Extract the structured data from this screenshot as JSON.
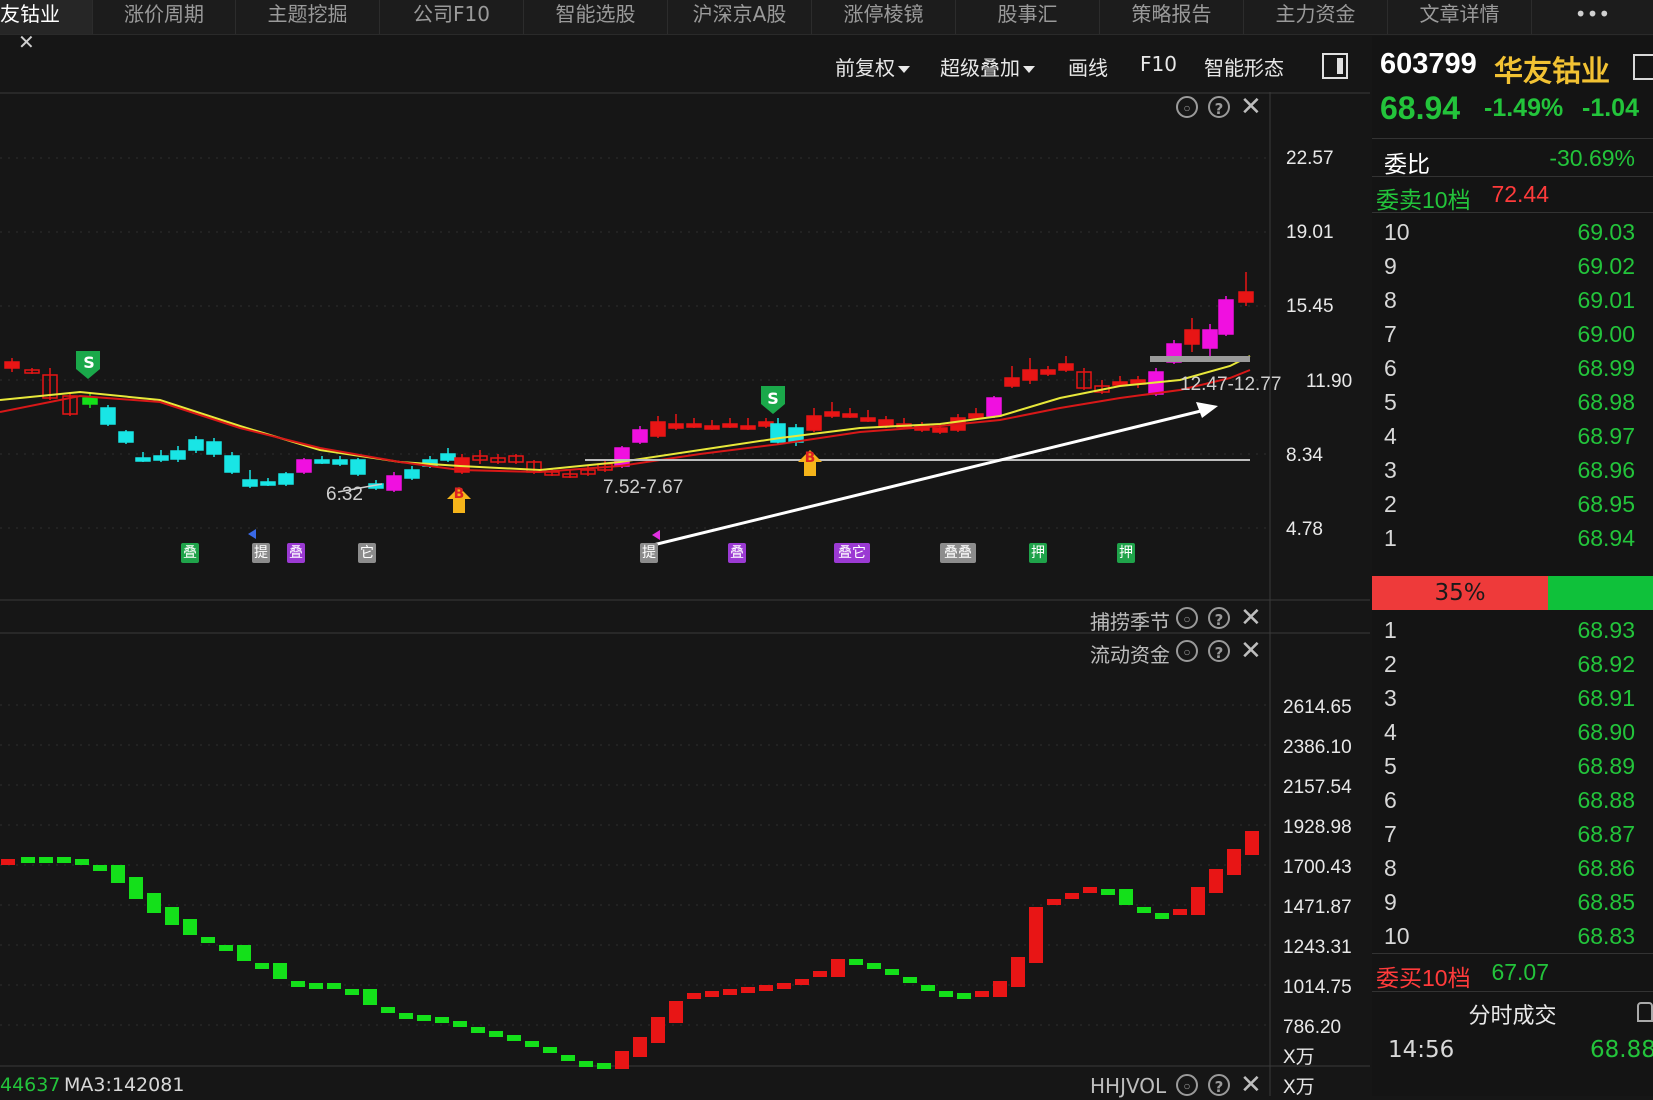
{
  "tabs": [
    "友钴业",
    "涨价周期",
    "主题挖掘",
    "公司F10",
    "智能选股",
    "沪深京A股",
    "涨停棱镜",
    "股事汇",
    "策略报告",
    "主力资金",
    "文章详情"
  ],
  "tab_close": "✕",
  "more": "•••",
  "toolbar": {
    "fuquan": "前复权",
    "diejia": "超级叠加",
    "huaxian": "画线",
    "f10": "F10",
    "xingtai": "智能形态"
  },
  "price_axis": [
    "22.57",
    "19.01",
    "15.45",
    "11.90",
    "8.34",
    "4.78"
  ],
  "flow_axis": [
    "2614.65",
    "2386.10",
    "2157.54",
    "1928.98",
    "1700.43",
    "1471.87",
    "1243.31",
    "1014.75",
    "786.20"
  ],
  "unit": "X万",
  "chart_labels": {
    "low1": "6.32",
    "range1": "7.52-7.67",
    "range2": "12.47-12.77"
  },
  "signals": {
    "s": "S",
    "b": "B"
  },
  "event_tags": [
    "叠",
    "提",
    "叠",
    "它",
    "提",
    "叠",
    "叠它",
    "叠叠",
    "押",
    "押"
  ],
  "pane_titles": {
    "season": "捕捞季节",
    "flow": "流动资金",
    "vol": "HHJVOL"
  },
  "pane_icons": {
    "help": "?",
    "close": "✕"
  },
  "bottom_left": {
    "val": "44637",
    "ma": "MA3:142081"
  },
  "colors": {
    "up": "#e81515",
    "down": "#14e01a",
    "magenta": "#f010e0",
    "cyan": "#19e5e5",
    "ma1": "#e8e83a",
    "ma2": "#d81818"
  },
  "stock": {
    "code": "603799",
    "name": "华友钴业",
    "price": "68.94",
    "pct": "-1.49%",
    "chg": "-1.04"
  },
  "weibi": {
    "label": "委比",
    "value": "-30.69%"
  },
  "sell_header": {
    "label": "委卖10档",
    "value": "72.44"
  },
  "asks": [
    {
      "lv": "10",
      "p": "69.03"
    },
    {
      "lv": "9",
      "p": "69.02"
    },
    {
      "lv": "8",
      "p": "69.01"
    },
    {
      "lv": "7",
      "p": "69.00"
    },
    {
      "lv": "6",
      "p": "68.99"
    },
    {
      "lv": "5",
      "p": "68.98"
    },
    {
      "lv": "4",
      "p": "68.97"
    },
    {
      "lv": "3",
      "p": "68.96"
    },
    {
      "lv": "2",
      "p": "68.95"
    },
    {
      "lv": "1",
      "p": "68.94"
    }
  ],
  "ratio": {
    "label": "35%",
    "red_fraction": 0.35
  },
  "bids": [
    {
      "lv": "1",
      "p": "68.93"
    },
    {
      "lv": "2",
      "p": "68.92"
    },
    {
      "lv": "3",
      "p": "68.91"
    },
    {
      "lv": "4",
      "p": "68.90"
    },
    {
      "lv": "5",
      "p": "68.89"
    },
    {
      "lv": "6",
      "p": "68.88"
    },
    {
      "lv": "7",
      "p": "68.87"
    },
    {
      "lv": "8",
      "p": "68.86"
    },
    {
      "lv": "9",
      "p": "68.85"
    },
    {
      "lv": "10",
      "p": "68.83"
    }
  ],
  "buy_header": {
    "label": "委买10档",
    "value": "67.07"
  },
  "trades": {
    "title": "分时成交",
    "time": "14:56",
    "price": "68.88"
  }
}
